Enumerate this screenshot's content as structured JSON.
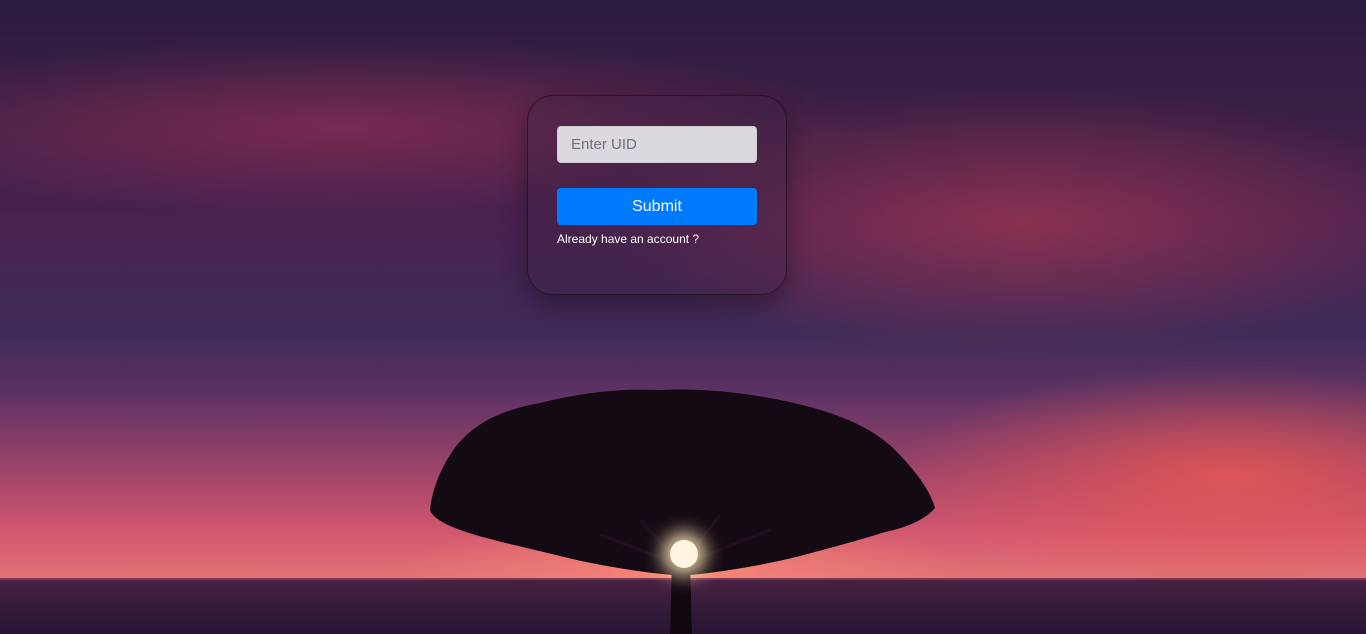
{
  "login": {
    "uid_placeholder": "Enter UID",
    "uid_value": "",
    "submit_label": "Submit",
    "account_link_label": "Already have an account ?"
  },
  "colors": {
    "accent": "#007bff",
    "text_light": "#ffffff"
  },
  "background": {
    "icon": "sunset-tree-image"
  }
}
